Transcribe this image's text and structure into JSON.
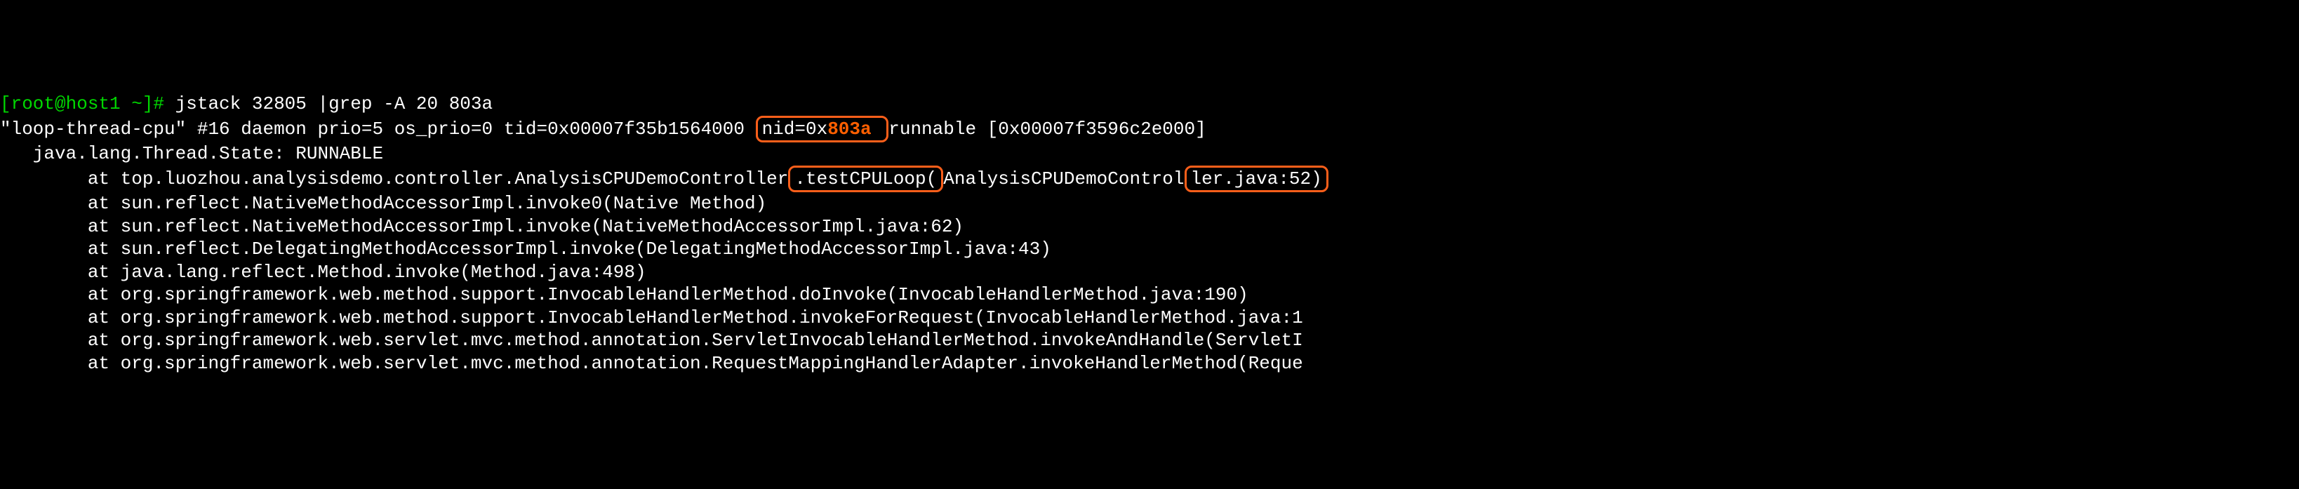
{
  "prompt": {
    "userhost": "[root@host1 ~]# ",
    "command": "jstack 32805 |grep -A 20 803a"
  },
  "thread_header": {
    "prefix": "\"loop-thread-cpu\" #16 daemon prio=5 os_prio=0 tid=0x00007f35b1564000 ",
    "nid_prefix": "nid=0x",
    "nid_highlight": "803a",
    "nid_space": " ",
    "suffix": "runnable [0x00007f3596c2e000]"
  },
  "state_line": "   java.lang.Thread.State: RUNNABLE",
  "frame_top": {
    "indent": "        at top.luozhou.analysisdemo.controller.AnalysisCPUDemoController",
    "method_box": ".testCPULoop(",
    "mid": "AnalysisCPUDemoControl",
    "end_box": "ler.java:52)"
  },
  "frames": [
    "        at sun.reflect.NativeMethodAccessorImpl.invoke0(Native Method)",
    "        at sun.reflect.NativeMethodAccessorImpl.invoke(NativeMethodAccessorImpl.java:62)",
    "        at sun.reflect.DelegatingMethodAccessorImpl.invoke(DelegatingMethodAccessorImpl.java:43)",
    "        at java.lang.reflect.Method.invoke(Method.java:498)",
    "        at org.springframework.web.method.support.InvocableHandlerMethod.doInvoke(InvocableHandlerMethod.java:190)",
    "        at org.springframework.web.method.support.InvocableHandlerMethod.invokeForRequest(InvocableHandlerMethod.java:1",
    "        at org.springframework.web.servlet.mvc.method.annotation.ServletInvocableHandlerMethod.invokeAndHandle(ServletI",
    "        at org.springframework.web.servlet.mvc.method.annotation.RequestMappingHandlerAdapter.invokeHandlerMethod(Reque"
  ]
}
